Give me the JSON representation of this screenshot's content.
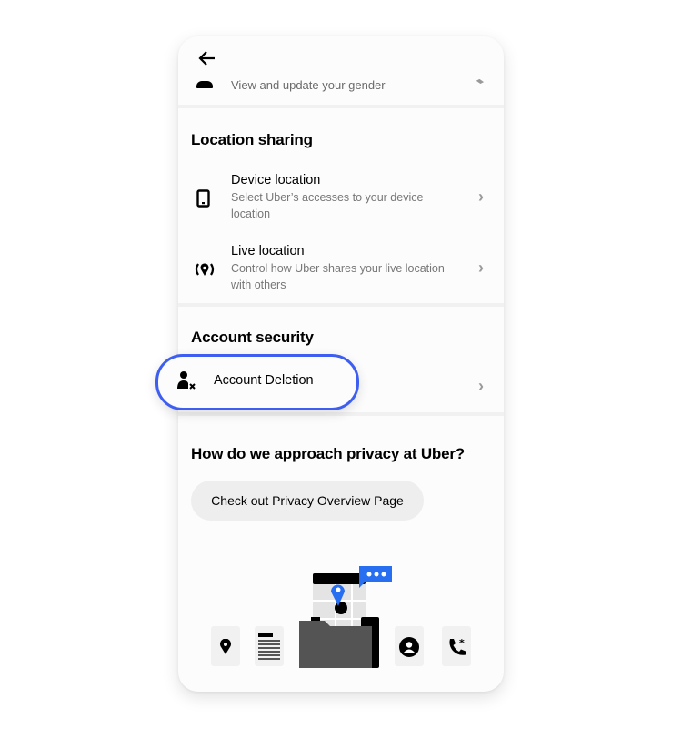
{
  "header": {
    "back_icon": "arrow-left-icon"
  },
  "gender_row": {
    "subtitle": "View and update your gender"
  },
  "location_sharing": {
    "title": "Location sharing",
    "items": [
      {
        "title": "Device location",
        "subtitle": "Select Uber’s accesses to your device location",
        "icon": "phone-icon"
      },
      {
        "title": "Live location",
        "subtitle": "Control how Uber shares your live location with others",
        "icon": "live-location-icon"
      }
    ]
  },
  "account_security": {
    "title": "Account security",
    "items": [
      {
        "title": "Account Deletion",
        "icon": "user-remove-icon"
      }
    ]
  },
  "privacy": {
    "title": "How do we approach privacy at Uber?",
    "button_label": "Check out Privacy Overview Page"
  },
  "colors": {
    "highlight": "#3d5ef0",
    "accent_blue": "#276ef1"
  }
}
